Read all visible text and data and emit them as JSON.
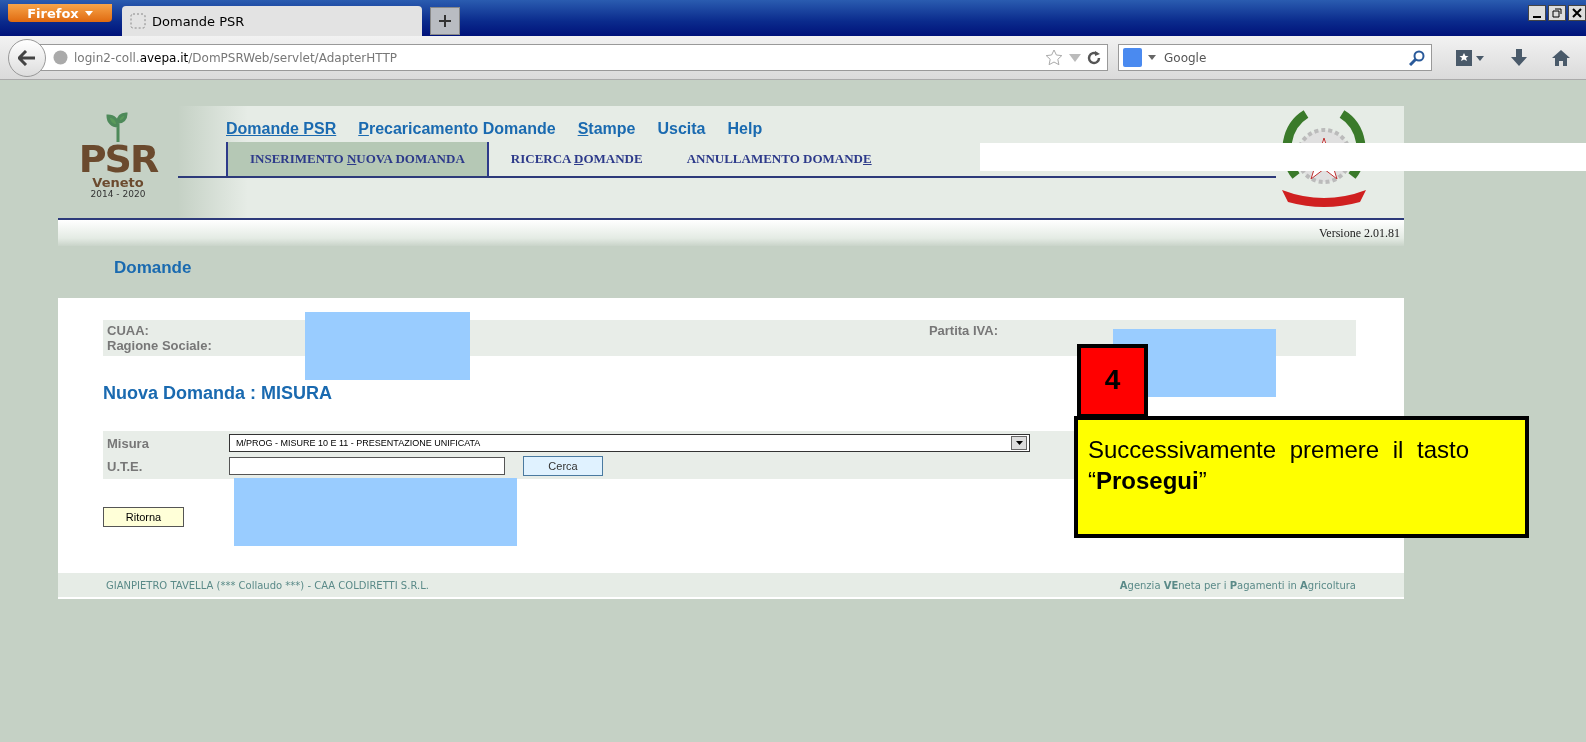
{
  "browser": {
    "app_button": "Firefox",
    "tab_title": "Domande PSR",
    "url": {
      "prefix": "login2-coll.",
      "domain": "avepa.it",
      "path": "/DomPSRWeb/servlet/AdapterHTTP"
    },
    "search_placeholder": "Google"
  },
  "header": {
    "logo": {
      "name": "PSR",
      "region": "Veneto",
      "years": "2014 - 2020"
    },
    "menu": [
      {
        "parts": [
          {
            "text": "Domande PSR",
            "underlined": true
          }
        ]
      },
      {
        "parts": [
          {
            "text": "P",
            "underlined": true
          },
          {
            "text": "recaricamento Domande",
            "underlined": false
          }
        ]
      },
      {
        "parts": [
          {
            "text": "S",
            "underlined": true
          },
          {
            "text": "tampe",
            "underlined": false
          }
        ]
      },
      {
        "parts": [
          {
            "text": "Uscita",
            "underlined": false
          }
        ]
      },
      {
        "parts": [
          {
            "text": "Help",
            "underlined": false
          }
        ]
      }
    ],
    "tabs": [
      {
        "selected": true,
        "parts": [
          {
            "text": "INSERIMENTO ",
            "underlined": false
          },
          {
            "text": "N",
            "underlined": true
          },
          {
            "text": "UOVA DOMANDA",
            "underlined": false
          }
        ]
      },
      {
        "selected": false,
        "parts": [
          {
            "text": "RICERCA ",
            "underlined": false
          },
          {
            "text": "D",
            "underlined": true
          },
          {
            "text": "OMANDE",
            "underlined": false
          }
        ]
      },
      {
        "selected": false,
        "parts": [
          {
            "text": "ANNULLAMENTO DOMAND",
            "underlined": false
          },
          {
            "text": "E",
            "underlined": true
          }
        ]
      }
    ],
    "version": "Versione 2.01.81"
  },
  "page_title": "Domande",
  "applicant": {
    "cuaa_label": "CUAA:",
    "ragione_label": "Ragione Sociale:",
    "piva_label": "Partita IVA:"
  },
  "section_title": "Nuova Domanda : MISURA",
  "form": {
    "misura_label": "Misura",
    "misura_value": "M/PROG - MISURE 10 E 11 - PRESENTAZIONE UNIFICATA",
    "ute_label": "U.T.E.",
    "search_button": "Cerca"
  },
  "back_button": "Ritorna",
  "footer": {
    "left": "GIANPIETRO TAVELLA (*** Collaudo ***) - CAA COLDIRETTI S.R.L.",
    "right": "**A**genzia **VE**neta per i **P**agamenti in **A**gricoltura"
  },
  "callout": {
    "number": "4",
    "text": "Successivamente premere il tasto “**Prosegui**”"
  }
}
